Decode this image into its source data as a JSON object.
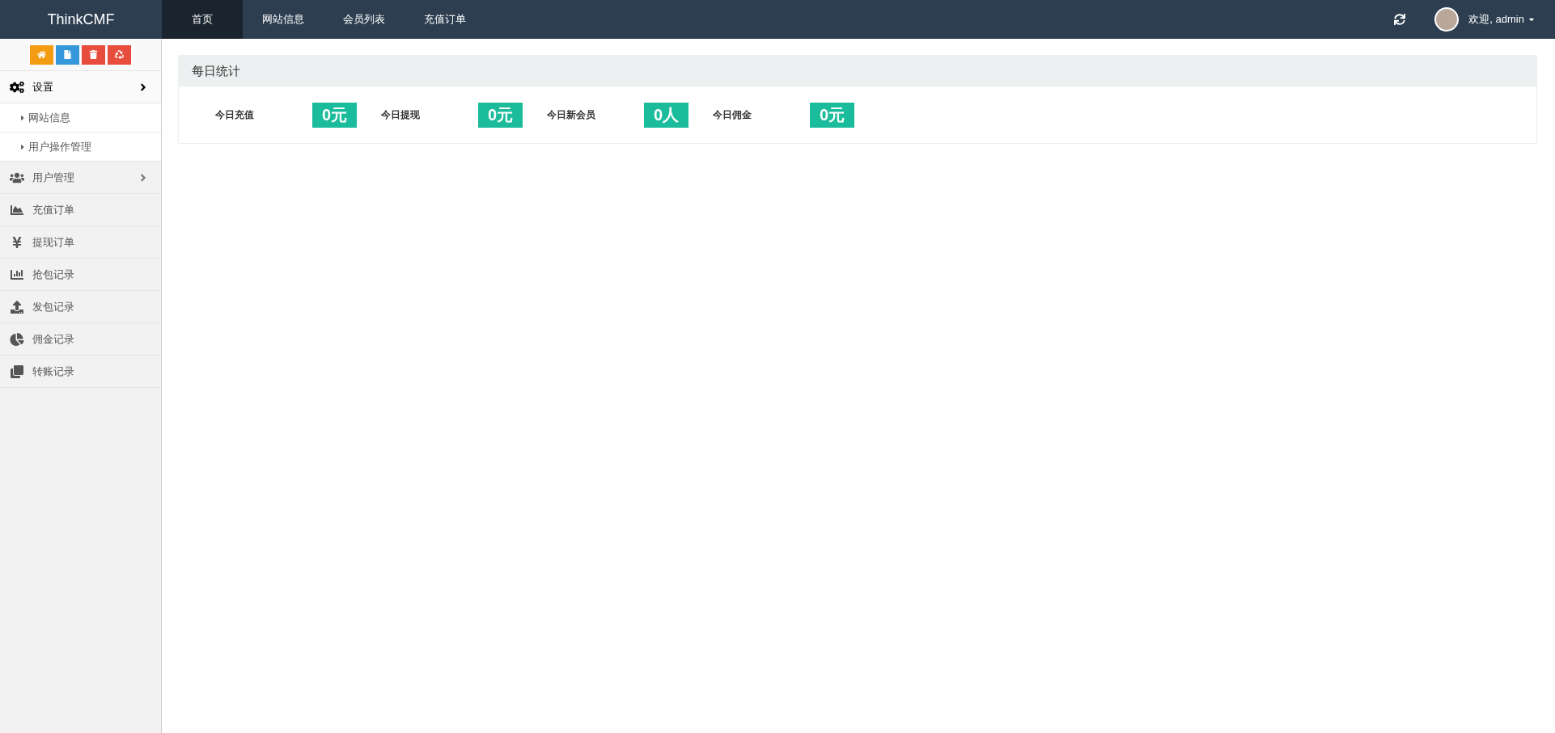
{
  "brand": "ThinkCMF",
  "top_nav": [
    {
      "label": "首页",
      "selected": true
    },
    {
      "label": "网站信息",
      "selected": false
    },
    {
      "label": "会员列表",
      "selected": false
    },
    {
      "label": "充值订单",
      "selected": false
    }
  ],
  "user": {
    "greeting": "欢迎, admin"
  },
  "sidebar": {
    "items": [
      {
        "label": "设置",
        "kind": "group",
        "expanded": true,
        "children": [
          {
            "label": "网站信息"
          },
          {
            "label": "用户操作管理"
          }
        ]
      },
      {
        "label": "用户管理",
        "kind": "group",
        "expanded": false
      },
      {
        "label": "充值订单",
        "kind": "link"
      },
      {
        "label": "提现订单",
        "kind": "link"
      },
      {
        "label": "抢包记录",
        "kind": "link"
      },
      {
        "label": "发包记录",
        "kind": "link"
      },
      {
        "label": "佣金记录",
        "kind": "link"
      },
      {
        "label": "转账记录",
        "kind": "link"
      }
    ]
  },
  "stats_panel": {
    "title": "每日统计",
    "stats": [
      {
        "label": "今日充值",
        "value": "0元"
      },
      {
        "label": "今日提现",
        "value": "0元"
      },
      {
        "label": "今日新会员",
        "value": "0人"
      },
      {
        "label": "今日佣金",
        "value": "0元"
      }
    ]
  }
}
